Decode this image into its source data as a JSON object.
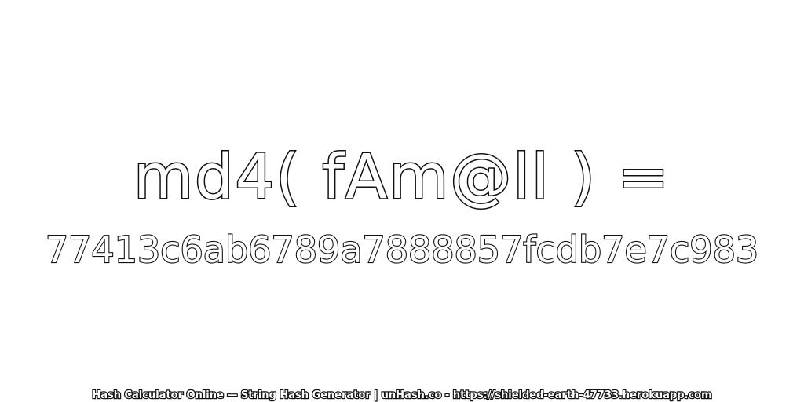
{
  "headline": "md4( fAm@ll ) =",
  "hash_value": "77413c6ab6789a7888857fcdb7e7c983",
  "footer": "Hash Calculator Online — String Hash Generator | unHash.co - https://shielded-earth-47733.herokuapp.com",
  "colors": {
    "background": "#ffffff",
    "outline": "#111111",
    "fill": "#ffffff"
  }
}
